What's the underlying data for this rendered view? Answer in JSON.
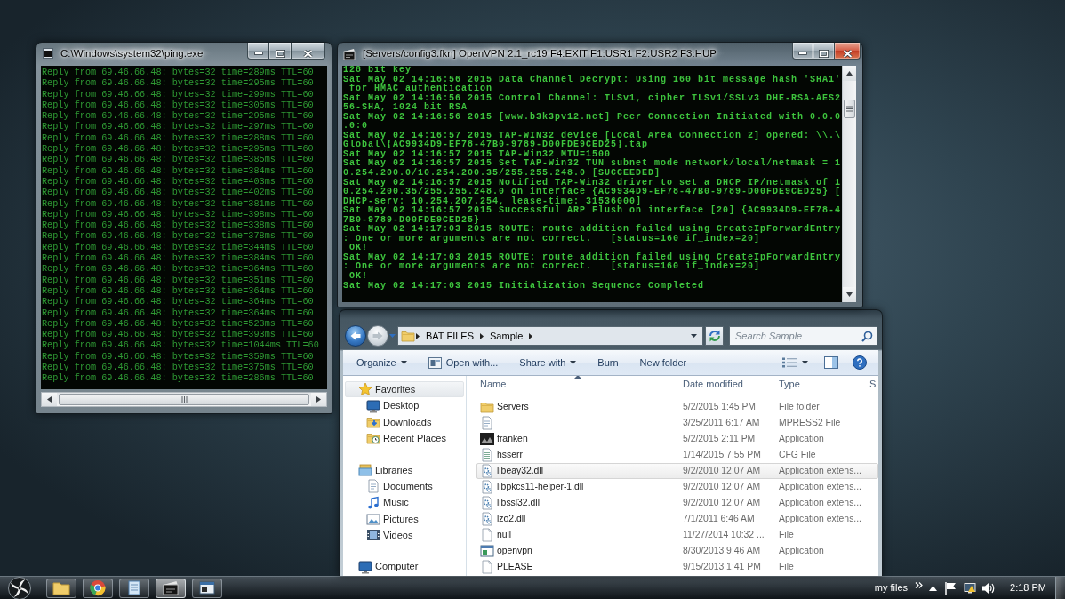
{
  "ping_window": {
    "title": "C:\\Windows\\system32\\ping.exe",
    "active": false,
    "lines": [
      "Reply from 69.46.66.48: bytes=32 time=289ms TTL=60",
      "Reply from 69.46.66.48: bytes=32 time=295ms TTL=60",
      "Reply from 69.46.66.48: bytes=32 time=299ms TTL=60",
      "Reply from 69.46.66.48: bytes=32 time=305ms TTL=60",
      "Reply from 69.46.66.48: bytes=32 time=295ms TTL=60",
      "Reply from 69.46.66.48: bytes=32 time=297ms TTL=60",
      "Reply from 69.46.66.48: bytes=32 time=288ms TTL=60",
      "Reply from 69.46.66.48: bytes=32 time=295ms TTL=60",
      "Reply from 69.46.66.48: bytes=32 time=385ms TTL=60",
      "Reply from 69.46.66.48: bytes=32 time=384ms TTL=60",
      "Reply from 69.46.66.48: bytes=32 time=403ms TTL=60",
      "Reply from 69.46.66.48: bytes=32 time=402ms TTL=60",
      "Reply from 69.46.66.48: bytes=32 time=381ms TTL=60",
      "Reply from 69.46.66.48: bytes=32 time=398ms TTL=60",
      "Reply from 69.46.66.48: bytes=32 time=338ms TTL=60",
      "Reply from 69.46.66.48: bytes=32 time=378ms TTL=60",
      "Reply from 69.46.66.48: bytes=32 time=344ms TTL=60",
      "Reply from 69.46.66.48: bytes=32 time=384ms TTL=60",
      "Reply from 69.46.66.48: bytes=32 time=364ms TTL=60",
      "Reply from 69.46.66.48: bytes=32 time=351ms TTL=60",
      "Reply from 69.46.66.48: bytes=32 time=364ms TTL=60",
      "Reply from 69.46.66.48: bytes=32 time=364ms TTL=60",
      "Reply from 69.46.66.48: bytes=32 time=364ms TTL=60",
      "Reply from 69.46.66.48: bytes=32 time=523ms TTL=60",
      "Reply from 69.46.66.48: bytes=32 time=393ms TTL=60",
      "Reply from 69.46.66.48: bytes=32 time=1044ms TTL=60",
      "Reply from 69.46.66.48: bytes=32 time=359ms TTL=60",
      "Reply from 69.46.66.48: bytes=32 time=375ms TTL=60",
      "Reply from 69.46.66.48: bytes=32 time=286ms TTL=60"
    ]
  },
  "openvpn_window": {
    "title": "[Servers/config3.fkn] OpenVPN 2.1_rc19 F4:EXIT F1:USR1 F2:USR2 F3:HUP",
    "active": true,
    "lines": [
      "128 bit key",
      "Sat May 02 14:16:56 2015 Data Channel Decrypt: Using 160 bit message hash 'SHA1'",
      " for HMAC authentication",
      "Sat May 02 14:16:56 2015 Control Channel: TLSv1, cipher TLSv1/SSLv3 DHE-RSA-AES2",
      "56-SHA, 1024 bit RSA",
      "Sat May 02 14:16:56 2015 [www.b3k3pv12.net] Peer Connection Initiated with 0.0.0",
      ".0:0",
      "Sat May 02 14:16:57 2015 TAP-WIN32 device [Local Area Connection 2] opened: \\\\.\\",
      "Global\\{AC9934D9-EF78-47B0-9789-D00FDE9CED25}.tap",
      "Sat May 02 14:16:57 2015 TAP-Win32 MTU=1500",
      "Sat May 02 14:16:57 2015 Set TAP-Win32 TUN subnet mode network/local/netmask = 1",
      "0.254.200.0/10.254.200.35/255.255.248.0 [SUCCEEDED]",
      "Sat May 02 14:16:57 2015 Notified TAP-Win32 driver to set a DHCP IP/netmask of 1",
      "0.254.200.35/255.255.248.0 on interface {AC9934D9-EF78-47B0-9789-D00FDE9CED25} [",
      "DHCP-serv: 10.254.207.254, lease-time: 31536000]",
      "Sat May 02 14:16:57 2015 Successful ARP Flush on interface [20] {AC9934D9-EF78-4",
      "7B0-9789-D00FDE9CED25}",
      "Sat May 02 14:17:03 2015 ROUTE: route addition failed using CreateIpForwardEntry",
      ": One or more arguments are not correct.   [status=160 if_index=20]",
      " OK!",
      "Sat May 02 14:17:03 2015 ROUTE: route addition failed using CreateIpForwardEntry",
      ": One or more arguments are not correct.   [status=160 if_index=20]",
      " OK!",
      "Sat May 02 14:17:03 2015 Initialization Sequence Completed"
    ]
  },
  "explorer_window": {
    "navigation": {
      "back": {
        "disabled": false
      },
      "forward": {
        "disabled": true
      }
    },
    "breadcrumb": [
      "BAT FILES",
      "Sample"
    ],
    "search": {
      "placeholder": "Search Sample"
    },
    "toolbar": [
      {
        "label": "Organize",
        "kind": "menu"
      },
      {
        "label": "Open with...",
        "kind": "icon"
      },
      {
        "label": "Share with",
        "kind": "menu"
      },
      {
        "label": "Burn",
        "kind": "plain"
      },
      {
        "label": "New folder",
        "kind": "plain"
      }
    ],
    "sidebar": {
      "items": [
        {
          "label": "Favorites",
          "kind": "star",
          "selected": true,
          "children": [
            {
              "label": "Desktop",
              "kind": "desktop",
              "selected": false
            },
            {
              "label": "Downloads",
              "kind": "downloads",
              "selected": false
            },
            {
              "label": "Recent Places",
              "kind": "recent",
              "selected": false
            }
          ]
        },
        {
          "label": "Libraries",
          "kind": "library",
          "selected": false,
          "children": [
            {
              "label": "Documents",
              "kind": "document",
              "selected": false
            },
            {
              "label": "Music",
              "kind": "music",
              "selected": false
            },
            {
              "label": "Pictures",
              "kind": "pictures",
              "selected": false
            },
            {
              "label": "Videos",
              "kind": "videos",
              "selected": false
            }
          ]
        },
        {
          "label": "Computer",
          "kind": "computer",
          "selected": false
        }
      ]
    },
    "table": {
      "columns": [
        {
          "label": "Name",
          "sorted": true
        },
        {
          "label": "Date modified",
          "sorted": false
        },
        {
          "label": "Type",
          "sorted": false
        },
        {
          "label": "S",
          "sorted": false
        }
      ],
      "rows": [
        {
          "kind": "folder",
          "name": "Servers",
          "date_modified": "5/2/2015 1:45 PM",
          "type": "File folder",
          "selected": false
        },
        {
          "kind": "document",
          "date_modified": "3/25/2011 6:17 AM",
          "type": "MPRESS2 File",
          "selected": false
        },
        {
          "kind": "image",
          "name": "franken",
          "date_modified": "5/2/2015 2:11 PM",
          "type": "Application",
          "selected": false
        },
        {
          "kind": "config",
          "name": "hsserr",
          "date_modified": "1/14/2015 7:55 PM",
          "type": "CFG File",
          "selected": false
        },
        {
          "kind": "extension",
          "name": "libeay32.dll",
          "date_modified": "9/2/2010 12:07 AM",
          "type": "Application extens...",
          "selected": true
        },
        {
          "kind": "extension",
          "name": "libpkcs11-helper-1.dll",
          "date_modified": "9/2/2010 12:07 AM",
          "type": "Application extens...",
          "selected": false
        },
        {
          "kind": "extension",
          "name": "libssl32.dll",
          "date_modified": "9/2/2010 12:07 AM",
          "type": "Application extens...",
          "selected": false
        },
        {
          "kind": "extension",
          "name": "lzo2.dll",
          "date_modified": "7/1/2011 6:46 AM",
          "type": "Application extens...",
          "selected": false
        },
        {
          "kind": "blank",
          "name": "null",
          "date_modified": "11/27/2014 10:32 ...",
          "type": "File",
          "selected": false
        },
        {
          "kind": "application",
          "name": "openvpn",
          "date_modified": "8/30/2013 9:46 AM",
          "type": "Application",
          "selected": false
        },
        {
          "kind": "blank",
          "name": "PLEASE",
          "date_modified": "9/15/2013 1:41 PM",
          "type": "File",
          "selected": false
        }
      ]
    }
  },
  "taskbar": {
    "apps": [
      {
        "kind": "folder",
        "active": false
      },
      {
        "kind": "browser",
        "active": false
      },
      {
        "kind": "notepad",
        "active": false
      },
      {
        "kind": "clapper",
        "active": true
      },
      {
        "kind": "console",
        "active": false
      }
    ],
    "toolbar_label": "my files",
    "clock": "2:18 PM"
  }
}
